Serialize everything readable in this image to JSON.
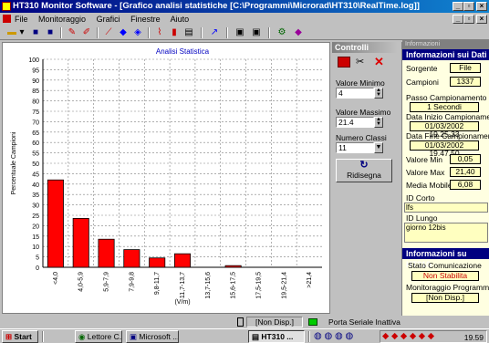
{
  "window": {
    "title": "HT310 Monitor Software - [Grafico analisi statistiche [C:\\Programmi\\Microrad\\HT310\\RealTime.log]]"
  },
  "menu": [
    "File",
    "Monitoraggio",
    "Grafici",
    "Finestre",
    "Aiuto"
  ],
  "chart_data": {
    "type": "bar",
    "title": "Analisi Statistica",
    "xlabel": "(V/m)",
    "ylabel": "Percentuale Campioni",
    "ylim": [
      0,
      100
    ],
    "yticks": [
      0,
      5,
      10,
      15,
      20,
      25,
      30,
      35,
      40,
      45,
      50,
      55,
      60,
      65,
      70,
      75,
      80,
      85,
      90,
      95,
      100
    ],
    "grid": true,
    "categories": [
      "<4,0",
      "4,0-5,9",
      "5,9-7,9",
      "7,9-9,8",
      "9,8-11,7",
      "11,7-13,7",
      "13,7-15,6",
      "15,6-17,5",
      "17,5-19,5",
      "19,5-21,4",
      ">21,4"
    ],
    "values": [
      42,
      23.5,
      13.5,
      8.5,
      4.5,
      6.5,
      0,
      0.8,
      0,
      0,
      0
    ],
    "bar_color": "#ff0000"
  },
  "controls": {
    "title": "Controlli",
    "min_label": "Valore Minimo",
    "min_value": "4",
    "max_label": "Valore Massimo",
    "max_value": "21.4",
    "classes_label": "Numero Classi",
    "classes_value": "11",
    "redraw_label": "Ridisegna"
  },
  "info": {
    "window_label": "Informazioni",
    "header": "Informazioni sui Dati",
    "sorgente_label": "Sorgente",
    "sorgente_value": "File",
    "campioni_label": "Campioni",
    "campioni_value": "1337",
    "passo_label": "Passo Campionamento",
    "passo_value": "1 Secondi",
    "inizio_label": "Data Inizio Campionamento",
    "inizio_value": "01/03/2002 19.25.33",
    "fine_label": "Data Fine Campionamento",
    "fine_value": "01/03/2002 19.47.50",
    "vmin_label": "Valore Min",
    "vmin_value": "0,05",
    "vmax_label": "Valore Max",
    "vmax_value": "21,40",
    "media_label": "Media Mobile",
    "media_value": "6,08",
    "idcorto_label": "ID Corto",
    "idcorto_value": "lfs",
    "idlungo_label": "ID Lungo",
    "idlungo_value": "giorno 12bis",
    "ht310_header": "Informazioni su HT310",
    "stato_label": "Stato Comunicazione",
    "stato_value": "Non Stabilita",
    "monitor_label": "Monitoraggio Programmato",
    "monitor_value": "[Non Disp.]"
  },
  "status": {
    "left": "[Non Disp.]",
    "right": "Porta Seriale Inattiva"
  },
  "taskbar": {
    "start": "Start",
    "items": [
      "Lettore C...",
      "Microsoft ...",
      "HT310 ..."
    ],
    "clock": "19.59"
  },
  "colors": {
    "titlebar": "#000080",
    "bars": "#ff0000",
    "info_bg": "#ffffe1",
    "info_value_bg": "#ffffc0",
    "status_red": "#cc0000"
  }
}
